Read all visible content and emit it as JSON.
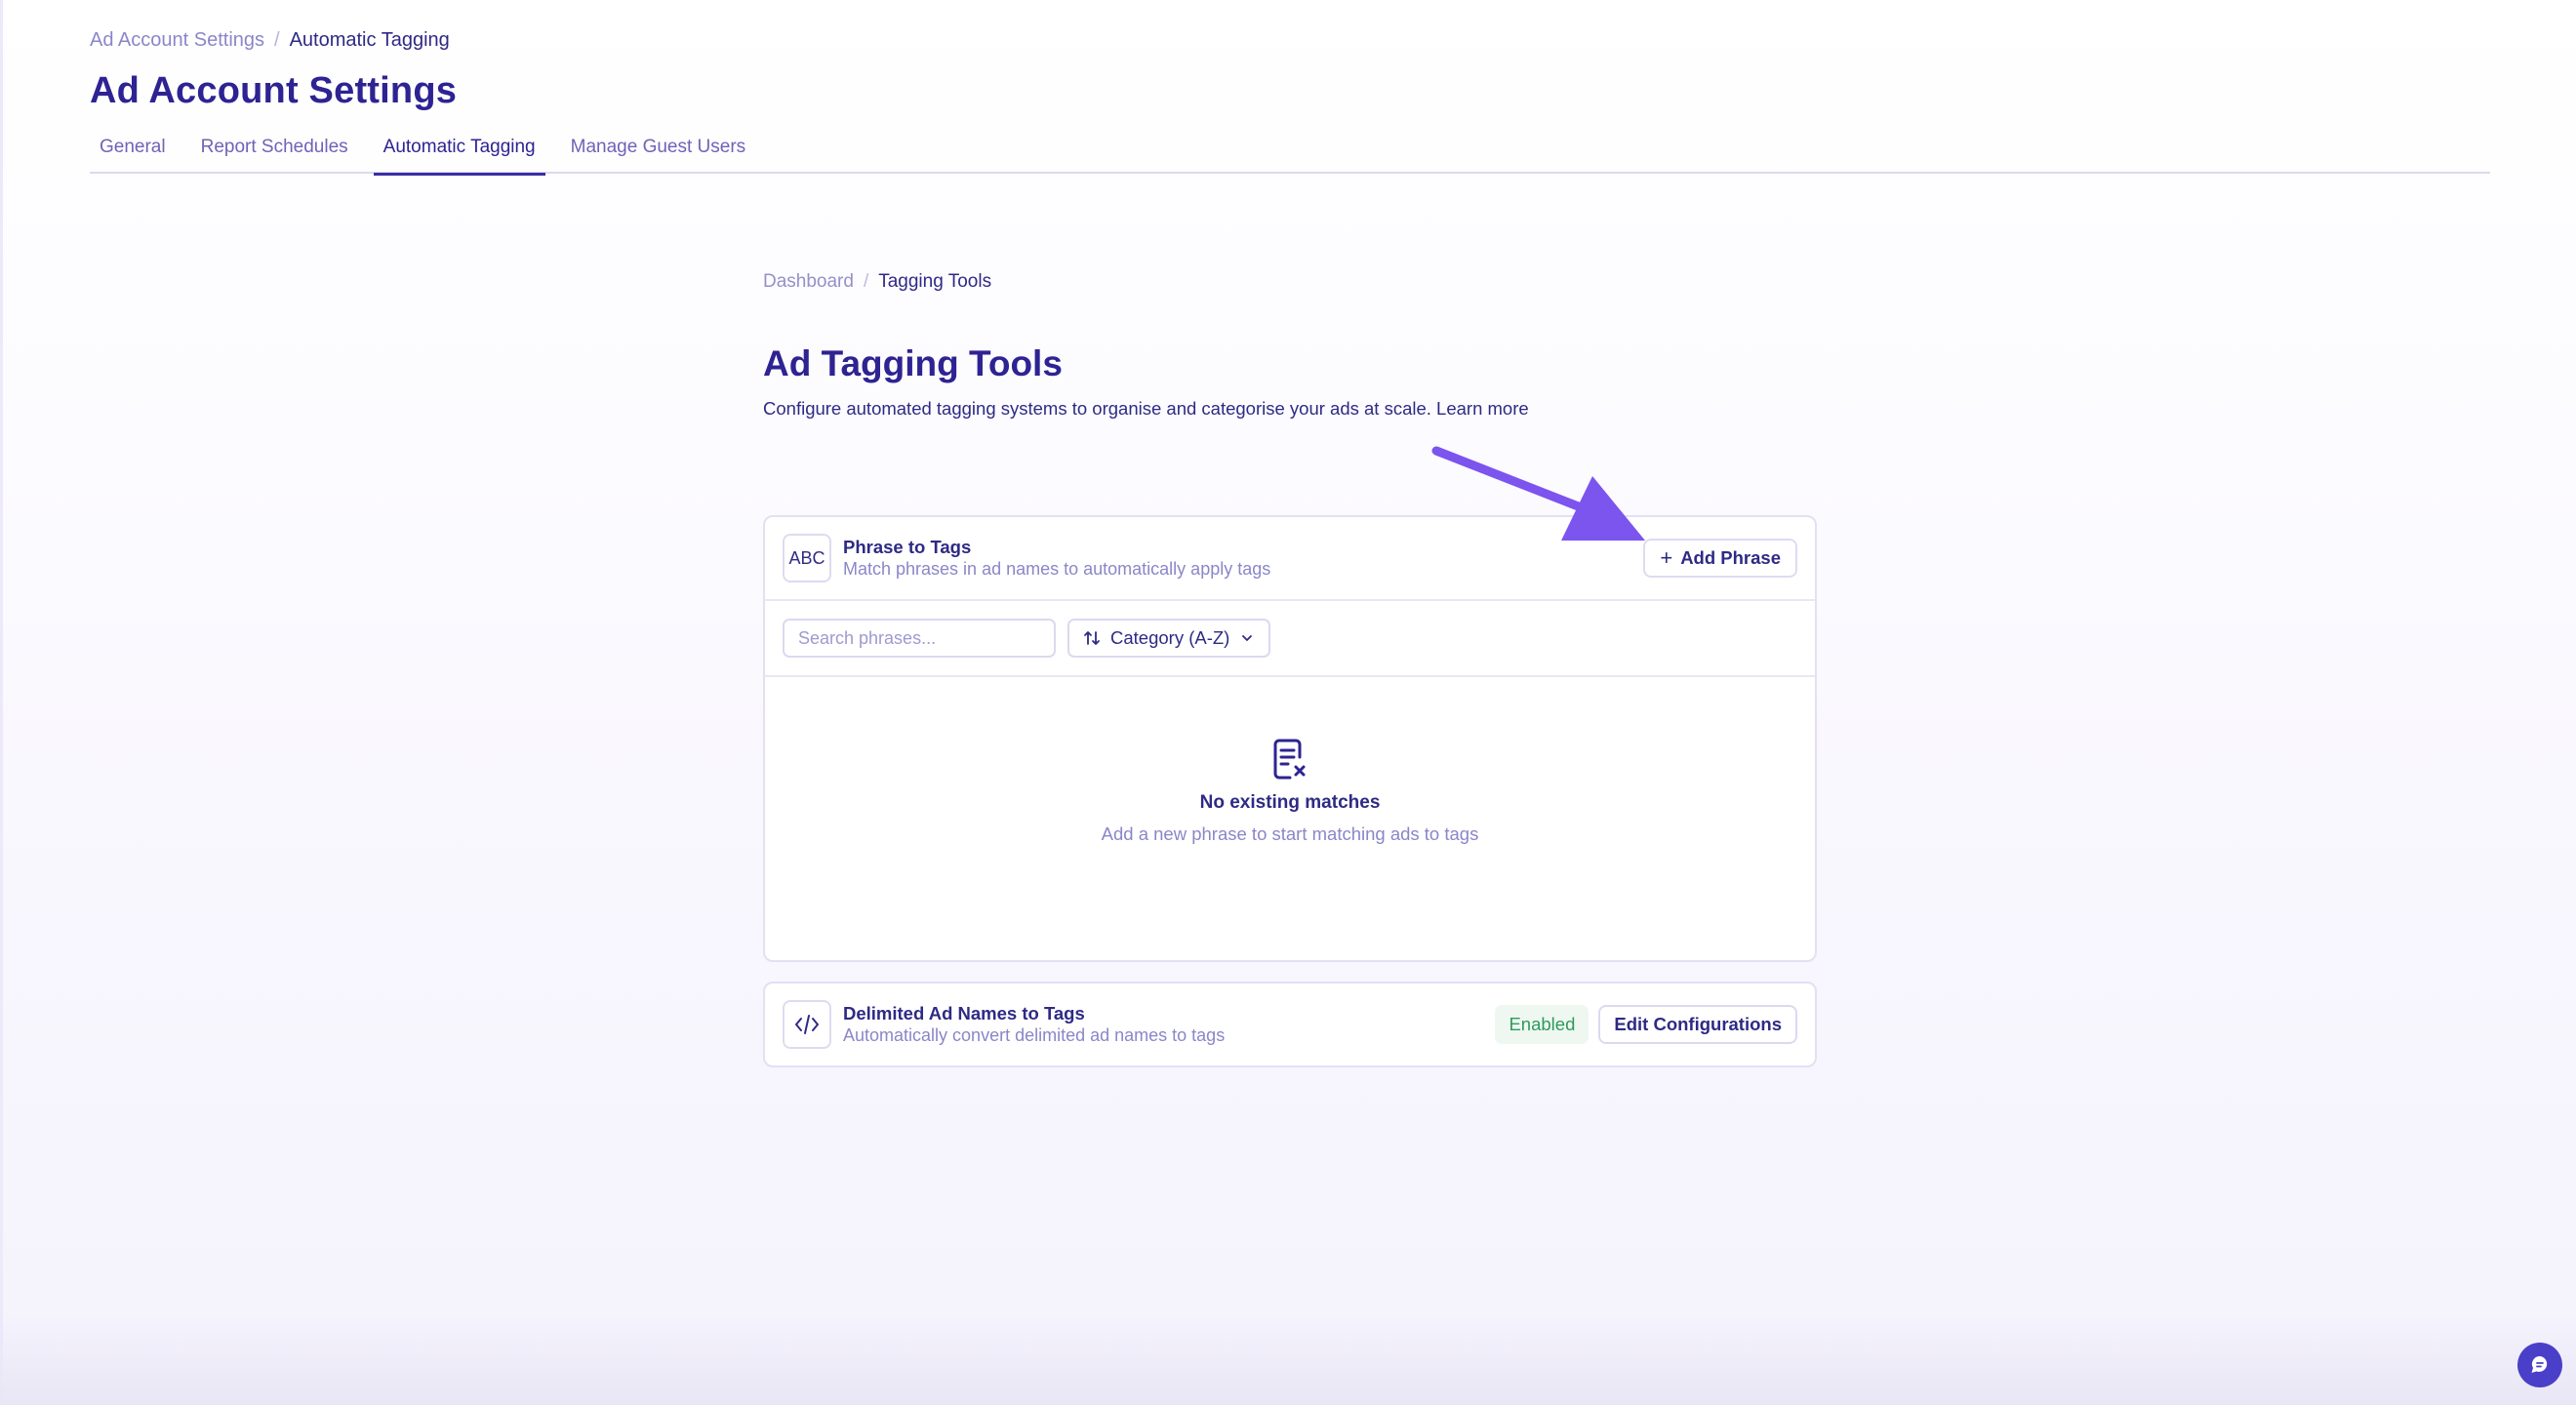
{
  "header": {
    "breadcrumb": {
      "parent": "Ad Account Settings",
      "separator": "/",
      "current": "Automatic Tagging"
    },
    "title": "Ad Account Settings",
    "tabs": [
      {
        "label": "General"
      },
      {
        "label": "Report Schedules"
      },
      {
        "label": "Automatic Tagging",
        "active": true
      },
      {
        "label": "Manage Guest Users"
      }
    ]
  },
  "main": {
    "breadcrumb": {
      "parent": "Dashboard",
      "separator": "/",
      "current": "Tagging Tools"
    },
    "title": "Ad Tagging Tools",
    "description": "Configure automated tagging systems to organise and categorise your ads at scale.",
    "learn_more": "Learn more",
    "phrase_card": {
      "icon_text": "ABC",
      "title": "Phrase to Tags",
      "subtitle": "Match phrases in ad names to automatically apply tags",
      "add_button": "Add Phrase",
      "add_icon": "+",
      "search_placeholder": "Search phrases...",
      "sort_label": "Category (A-Z)",
      "empty_title": "No existing matches",
      "empty_subtitle": "Add a new phrase to start matching ads to tags"
    },
    "delimited_card": {
      "title": "Delimited Ad Names to Tags",
      "subtitle": "Automatically convert delimited ad names to tags",
      "status": "Enabled",
      "edit_button": "Edit Configurations"
    }
  },
  "colors": {
    "primary": "#2e2392",
    "muted": "#8a86c9",
    "annotation_arrow": "#7c54ee",
    "enabled_green": "#2f9a5c",
    "chat": "#4a3fc8"
  },
  "icons": [
    "document-x-icon",
    "code-icon",
    "sort-icon",
    "chevron-down-icon",
    "plus-icon",
    "chat-icon",
    "arrow-annotation"
  ]
}
